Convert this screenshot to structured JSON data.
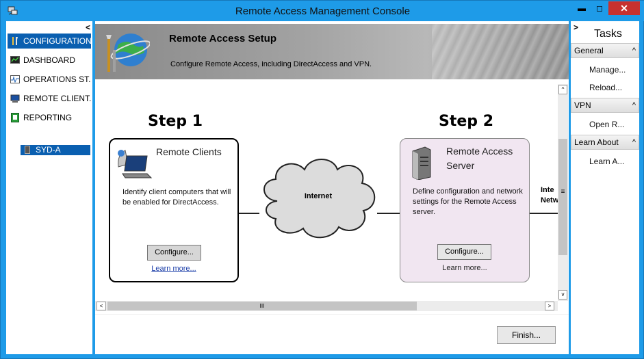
{
  "window": {
    "title": "Remote Access Management Console",
    "minimize_glyph": "▬",
    "maximize_glyph": "◻",
    "close_glyph": "✕"
  },
  "nav": {
    "collapse_glyph": "<",
    "items": [
      {
        "label": "CONFIGURATION",
        "icon": "configuration-icon",
        "selected": true
      },
      {
        "label": "DASHBOARD",
        "icon": "dashboard-icon"
      },
      {
        "label": "OPERATIONS ST...",
        "icon": "operations-status-icon"
      },
      {
        "label": "REMOTE CLIENT...",
        "icon": "remote-client-icon"
      },
      {
        "label": "REPORTING",
        "icon": "reporting-icon"
      }
    ],
    "server": "SYD-A"
  },
  "banner": {
    "title": "Remote Access Setup",
    "subtitle": "Configure Remote Access, including DirectAccess and VPN."
  },
  "steps": {
    "step1": {
      "label": "Step 1",
      "title": "Remote Clients",
      "description": "Identify client computers that will be enabled for DirectAccess.",
      "button": "Configure...",
      "link": "Learn more..."
    },
    "step2": {
      "label": "Step 2",
      "title": "Remote Access Server",
      "description": "Define configuration and network settings for the Remote Access server.",
      "button": "Configure...",
      "link": "Learn more..."
    },
    "cloud_label": "Internet",
    "cut_label_line1": "Inte",
    "cut_label_line2": "Netw"
  },
  "scroll": {
    "up": "^",
    "down": "v",
    "left": "<",
    "right": ">",
    "grip_h": "III",
    "grip_v": "≡"
  },
  "footer": {
    "finish": "Finish..."
  },
  "tasks": {
    "expand_glyph": ">",
    "title": "Tasks",
    "sections": [
      {
        "label": "General",
        "items": [
          "Manage...",
          "Reload..."
        ]
      },
      {
        "label": "VPN",
        "items": [
          "Open R..."
        ]
      },
      {
        "label": "Learn About",
        "items": [
          "Learn A..."
        ]
      }
    ],
    "caret": "^"
  },
  "colors": {
    "frame": "#1e9be8",
    "selected": "#0a5fb0",
    "close": "#c7312f",
    "step2_card": "#f1e6f1"
  }
}
